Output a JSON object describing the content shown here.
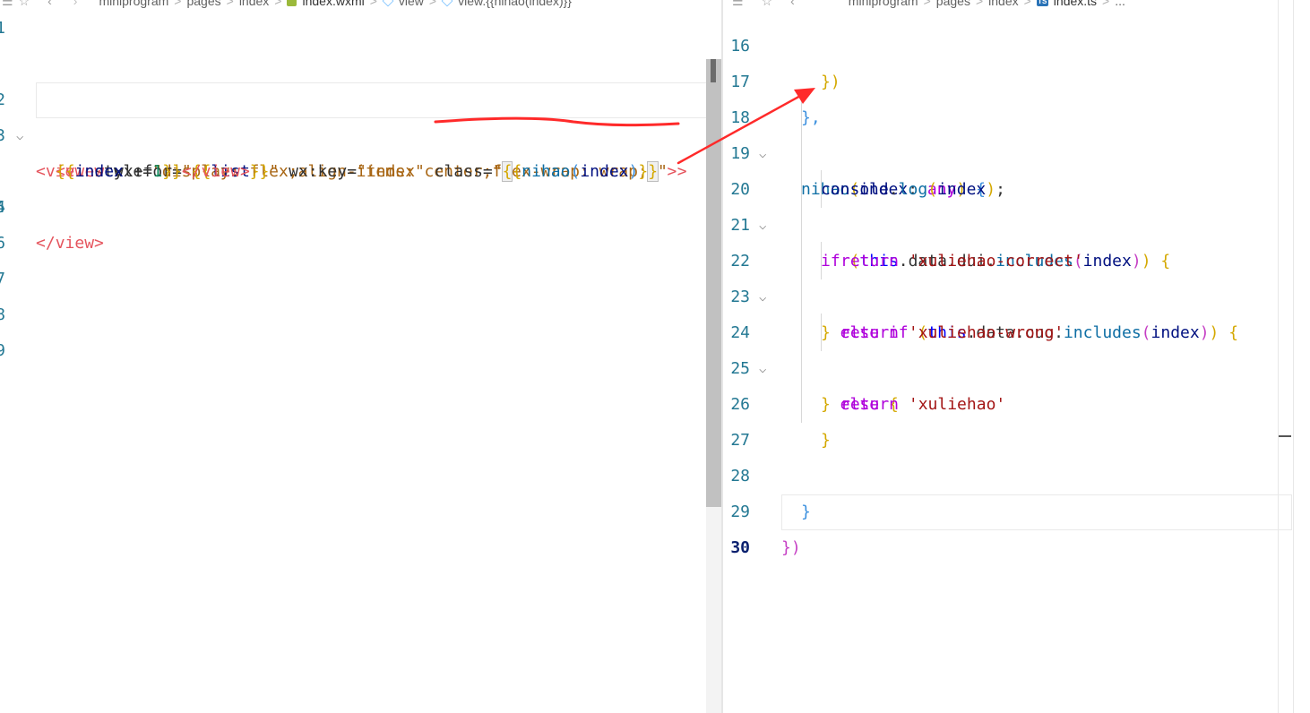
{
  "left_editor": {
    "breadcrumb": {
      "segments": [
        "miniprogram",
        "pages",
        "index",
        "index.wxml",
        "view",
        "view.{{nihao(index)}}"
      ],
      "separator": ">"
    },
    "line_numbers": [
      "1",
      "2",
      "3",
      "",
      "4",
      "5",
      "6",
      "7",
      "8",
      "9"
    ],
    "lines": {
      "l2": {
        "open": "<",
        "tag": "view",
        "attr": " style",
        "eq": "=",
        "value": "\"display: flex;align-items: center;flex-wrap: wrap;\"",
        "close": " >"
      },
      "l3": {
        "open": "<",
        "tag": "view",
        "attr1": " wx:for",
        "eq1": "=",
        "q1": "\"",
        "b_open": "{{",
        "var1": "list",
        "b_close": "}}",
        "q1_end": "\"",
        "attr2": " wx:key",
        "eq2": "=",
        "val2": "\"index\"",
        "attr3": " class",
        "eq3": "=",
        "q3": "\"",
        "b3_open1": "{",
        "b3_open2": "{",
        "fn": "nihao",
        "p_open": "(",
        "arg": "index",
        "p_close": ")",
        "b3_close1": "}",
        "b3_close2": "}",
        "q3_end": "\"",
        "close": " >"
      },
      "l3_wrap": {
        "b_open": "{{",
        "var": "index",
        "op": " + ",
        "num": "1",
        "b_close": "}}",
        "end_open": "</",
        "end_tag": "view",
        "end_close": ">"
      },
      "l4": {
        "end_open": "</",
        "end_tag": "view",
        "end_close": ">"
      }
    }
  },
  "right_editor": {
    "breadcrumb": {
      "segments": [
        "miniprogram",
        "pages",
        "index",
        "TS",
        "index.ts",
        "..."
      ],
      "separator": ">"
    },
    "line_numbers": [
      "16",
      "17",
      "18",
      "19",
      "20",
      "21",
      "22",
      "23",
      "24",
      "25",
      "26",
      "27",
      "28",
      "29",
      "30"
    ],
    "lines": {
      "l16": "})",
      "l17": "},",
      "l18": {
        "fn": "nihao",
        "p_open": "(",
        "param": "index",
        "colon": ": ",
        "type": "any",
        "p_close": ")",
        "brace": " {"
      },
      "l19": {
        "obj": "console",
        "dot": ".",
        "fn": "log",
        "p_open": "(",
        "arg": "index",
        "p_close": ")",
        "semi": ";"
      },
      "l20": {
        "kw": "if",
        "sp": " ",
        "p_open": "(",
        "this": "this",
        "chain": ".data.dui.",
        "fn": "includes",
        "ip_open": "(",
        "arg": "index",
        "ip_close": ")",
        "p_close": ")",
        "brace": " {"
      },
      "l21": {
        "kw": "return",
        "str": " 'xuliehao-correct'"
      },
      "l22": {
        "brace_close": "}",
        "kw": " else if",
        "sp": " ",
        "p_open": "(",
        "this": "this",
        "chain": ".data.cuo.",
        "fn": "includes",
        "ip_open": "(",
        "arg": "index",
        "ip_close": ")",
        "p_close": ")",
        "brace": " {"
      },
      "l23": {
        "kw": "return",
        "str": " 'xuliehao-wrong'"
      },
      "l24": {
        "brace_close": "}",
        "kw": " else",
        "brace": " {"
      },
      "l25": {
        "kw": "return",
        "str": " 'xuliehao'"
      },
      "l26": "}",
      "l27": "",
      "l28": "}",
      "l29": "})",
      "l30": ""
    }
  },
  "colors": {
    "annotation_red": "#ff2a2a",
    "line_number": "#237893",
    "tag": "#e5545d",
    "string_value": "#a86614",
    "keyword_blue": "#0000ff",
    "control_purple": "#af00db",
    "function": "#0e6ea4",
    "variable": "#001080",
    "string": "#a31515"
  },
  "icons": {
    "left_pane": [
      "list-icon",
      "star-icon",
      "back-icon",
      "forward-icon",
      "wxml-file-icon",
      "view-cube-icon"
    ],
    "right_pane": [
      "list-icon",
      "star-icon",
      "back-icon",
      "typescript-file-icon"
    ]
  }
}
